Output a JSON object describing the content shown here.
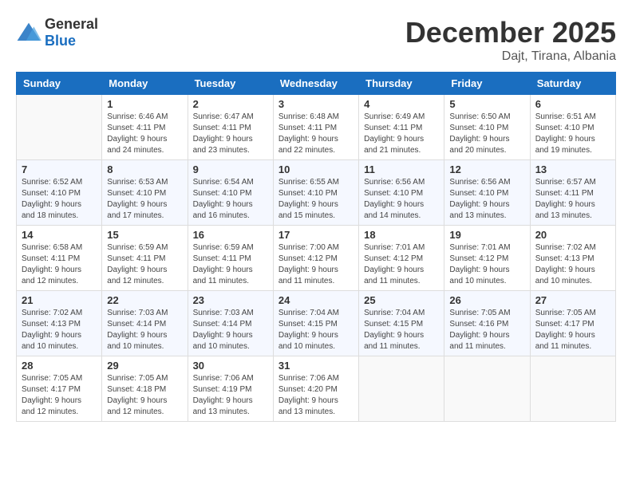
{
  "header": {
    "logo_general": "General",
    "logo_blue": "Blue",
    "month": "December 2025",
    "location": "Dajt, Tirana, Albania"
  },
  "weekdays": [
    "Sunday",
    "Monday",
    "Tuesday",
    "Wednesday",
    "Thursday",
    "Friday",
    "Saturday"
  ],
  "weeks": [
    [
      {
        "day": "",
        "sunrise": "",
        "sunset": "",
        "daylight": ""
      },
      {
        "day": "1",
        "sunrise": "Sunrise: 6:46 AM",
        "sunset": "Sunset: 4:11 PM",
        "daylight": "Daylight: 9 hours and 24 minutes."
      },
      {
        "day": "2",
        "sunrise": "Sunrise: 6:47 AM",
        "sunset": "Sunset: 4:11 PM",
        "daylight": "Daylight: 9 hours and 23 minutes."
      },
      {
        "day": "3",
        "sunrise": "Sunrise: 6:48 AM",
        "sunset": "Sunset: 4:11 PM",
        "daylight": "Daylight: 9 hours and 22 minutes."
      },
      {
        "day": "4",
        "sunrise": "Sunrise: 6:49 AM",
        "sunset": "Sunset: 4:11 PM",
        "daylight": "Daylight: 9 hours and 21 minutes."
      },
      {
        "day": "5",
        "sunrise": "Sunrise: 6:50 AM",
        "sunset": "Sunset: 4:10 PM",
        "daylight": "Daylight: 9 hours and 20 minutes."
      },
      {
        "day": "6",
        "sunrise": "Sunrise: 6:51 AM",
        "sunset": "Sunset: 4:10 PM",
        "daylight": "Daylight: 9 hours and 19 minutes."
      }
    ],
    [
      {
        "day": "7",
        "sunrise": "Sunrise: 6:52 AM",
        "sunset": "Sunset: 4:10 PM",
        "daylight": "Daylight: 9 hours and 18 minutes."
      },
      {
        "day": "8",
        "sunrise": "Sunrise: 6:53 AM",
        "sunset": "Sunset: 4:10 PM",
        "daylight": "Daylight: 9 hours and 17 minutes."
      },
      {
        "day": "9",
        "sunrise": "Sunrise: 6:54 AM",
        "sunset": "Sunset: 4:10 PM",
        "daylight": "Daylight: 9 hours and 16 minutes."
      },
      {
        "day": "10",
        "sunrise": "Sunrise: 6:55 AM",
        "sunset": "Sunset: 4:10 PM",
        "daylight": "Daylight: 9 hours and 15 minutes."
      },
      {
        "day": "11",
        "sunrise": "Sunrise: 6:56 AM",
        "sunset": "Sunset: 4:10 PM",
        "daylight": "Daylight: 9 hours and 14 minutes."
      },
      {
        "day": "12",
        "sunrise": "Sunrise: 6:56 AM",
        "sunset": "Sunset: 4:10 PM",
        "daylight": "Daylight: 9 hours and 13 minutes."
      },
      {
        "day": "13",
        "sunrise": "Sunrise: 6:57 AM",
        "sunset": "Sunset: 4:11 PM",
        "daylight": "Daylight: 9 hours and 13 minutes."
      }
    ],
    [
      {
        "day": "14",
        "sunrise": "Sunrise: 6:58 AM",
        "sunset": "Sunset: 4:11 PM",
        "daylight": "Daylight: 9 hours and 12 minutes."
      },
      {
        "day": "15",
        "sunrise": "Sunrise: 6:59 AM",
        "sunset": "Sunset: 4:11 PM",
        "daylight": "Daylight: 9 hours and 12 minutes."
      },
      {
        "day": "16",
        "sunrise": "Sunrise: 6:59 AM",
        "sunset": "Sunset: 4:11 PM",
        "daylight": "Daylight: 9 hours and 11 minutes."
      },
      {
        "day": "17",
        "sunrise": "Sunrise: 7:00 AM",
        "sunset": "Sunset: 4:12 PM",
        "daylight": "Daylight: 9 hours and 11 minutes."
      },
      {
        "day": "18",
        "sunrise": "Sunrise: 7:01 AM",
        "sunset": "Sunset: 4:12 PM",
        "daylight": "Daylight: 9 hours and 11 minutes."
      },
      {
        "day": "19",
        "sunrise": "Sunrise: 7:01 AM",
        "sunset": "Sunset: 4:12 PM",
        "daylight": "Daylight: 9 hours and 10 minutes."
      },
      {
        "day": "20",
        "sunrise": "Sunrise: 7:02 AM",
        "sunset": "Sunset: 4:13 PM",
        "daylight": "Daylight: 9 hours and 10 minutes."
      }
    ],
    [
      {
        "day": "21",
        "sunrise": "Sunrise: 7:02 AM",
        "sunset": "Sunset: 4:13 PM",
        "daylight": "Daylight: 9 hours and 10 minutes."
      },
      {
        "day": "22",
        "sunrise": "Sunrise: 7:03 AM",
        "sunset": "Sunset: 4:14 PM",
        "daylight": "Daylight: 9 hours and 10 minutes."
      },
      {
        "day": "23",
        "sunrise": "Sunrise: 7:03 AM",
        "sunset": "Sunset: 4:14 PM",
        "daylight": "Daylight: 9 hours and 10 minutes."
      },
      {
        "day": "24",
        "sunrise": "Sunrise: 7:04 AM",
        "sunset": "Sunset: 4:15 PM",
        "daylight": "Daylight: 9 hours and 10 minutes."
      },
      {
        "day": "25",
        "sunrise": "Sunrise: 7:04 AM",
        "sunset": "Sunset: 4:15 PM",
        "daylight": "Daylight: 9 hours and 11 minutes."
      },
      {
        "day": "26",
        "sunrise": "Sunrise: 7:05 AM",
        "sunset": "Sunset: 4:16 PM",
        "daylight": "Daylight: 9 hours and 11 minutes."
      },
      {
        "day": "27",
        "sunrise": "Sunrise: 7:05 AM",
        "sunset": "Sunset: 4:17 PM",
        "daylight": "Daylight: 9 hours and 11 minutes."
      }
    ],
    [
      {
        "day": "28",
        "sunrise": "Sunrise: 7:05 AM",
        "sunset": "Sunset: 4:17 PM",
        "daylight": "Daylight: 9 hours and 12 minutes."
      },
      {
        "day": "29",
        "sunrise": "Sunrise: 7:05 AM",
        "sunset": "Sunset: 4:18 PM",
        "daylight": "Daylight: 9 hours and 12 minutes."
      },
      {
        "day": "30",
        "sunrise": "Sunrise: 7:06 AM",
        "sunset": "Sunset: 4:19 PM",
        "daylight": "Daylight: 9 hours and 13 minutes."
      },
      {
        "day": "31",
        "sunrise": "Sunrise: 7:06 AM",
        "sunset": "Sunset: 4:20 PM",
        "daylight": "Daylight: 9 hours and 13 minutes."
      },
      {
        "day": "",
        "sunrise": "",
        "sunset": "",
        "daylight": ""
      },
      {
        "day": "",
        "sunrise": "",
        "sunset": "",
        "daylight": ""
      },
      {
        "day": "",
        "sunrise": "",
        "sunset": "",
        "daylight": ""
      }
    ]
  ]
}
